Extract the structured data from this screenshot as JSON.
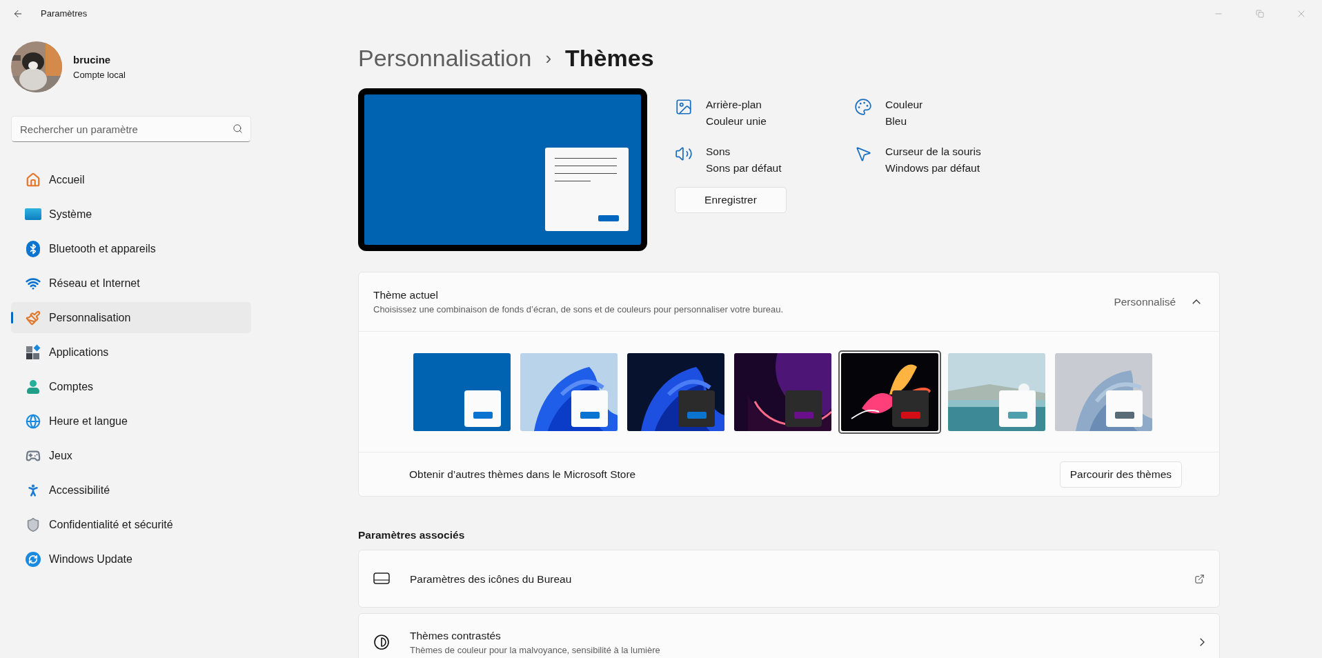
{
  "window": {
    "title": "Paramètres"
  },
  "account": {
    "name": "brucine",
    "type": "Compte local"
  },
  "search": {
    "placeholder": "Rechercher un paramètre"
  },
  "sidebar": {
    "items": [
      {
        "label": "Accueil",
        "selected": false
      },
      {
        "label": "Système",
        "selected": false
      },
      {
        "label": "Bluetooth et appareils",
        "selected": false
      },
      {
        "label": "Réseau et Internet",
        "selected": false
      },
      {
        "label": "Personnalisation",
        "selected": true
      },
      {
        "label": "Applications",
        "selected": false
      },
      {
        "label": "Comptes",
        "selected": false
      },
      {
        "label": "Heure et langue",
        "selected": false
      },
      {
        "label": "Jeux",
        "selected": false
      },
      {
        "label": "Accessibilité",
        "selected": false
      },
      {
        "label": "Confidentialité et sécurité",
        "selected": false
      },
      {
        "label": "Windows Update",
        "selected": false
      }
    ]
  },
  "breadcrumb": [
    "Personnalisation",
    "›",
    "Thèmes"
  ],
  "theme_properties": [
    {
      "label": "Arrière-plan",
      "value": "Couleur unie"
    },
    {
      "label": "Couleur",
      "value": "Bleu"
    },
    {
      "label": "Sons",
      "value": "Sons par défaut"
    },
    {
      "label": "Curseur de la souris",
      "value": "Windows par défaut"
    }
  ],
  "save_button": "Enregistrer",
  "current_theme": {
    "title": "Thème actuel",
    "description": "Choisissez une combinaison de fonds d’écran, de sons et de couleurs pour personnaliser votre bureau.",
    "value": "Personnalisé",
    "expanded": true,
    "themes": [
      {
        "kind": "solid",
        "dark_window": false,
        "color": "#0a74d0",
        "selected": false
      },
      {
        "kind": "picture",
        "dark_window": false,
        "color": "#0a74d0",
        "selected": false
      },
      {
        "kind": "picture",
        "dark_window": true,
        "color": "#0a74d0",
        "selected": false
      },
      {
        "kind": "picture",
        "dark_window": true,
        "color": "#6a0f8a",
        "selected": false
      },
      {
        "kind": "picture",
        "dark_window": true,
        "color": "#d40e17",
        "selected": true
      },
      {
        "kind": "picture",
        "dark_window": false,
        "color": "#4ea0ad",
        "selected": false
      },
      {
        "kind": "picture",
        "dark_window": false,
        "color": "#5a6b78",
        "selected": false
      }
    ],
    "store_text": "Obtenir d’autres thèmes dans le Microsoft Store",
    "store_button": "Parcourir des thèmes"
  },
  "related": {
    "title": "Paramètres associés",
    "items": [
      {
        "kind": "external",
        "title": "Paramètres des icônes du Bureau"
      },
      {
        "kind": "page",
        "title": "Thèmes contrastés",
        "description": "Thèmes de couleur pour la malvoyance, sensibilité à la lumière"
      }
    ]
  }
}
